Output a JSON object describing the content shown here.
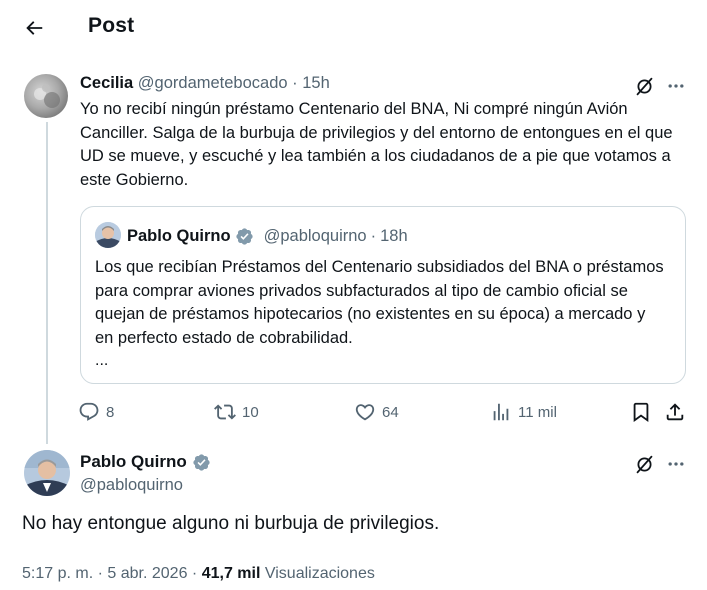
{
  "header": {
    "title": "Post"
  },
  "reply": {
    "name": "Cecilia",
    "handle": "@gordametebocado",
    "separator": "·",
    "time": "15h",
    "text": "Yo no recibí ningún préstamo Centenario del BNA, Ni compré ningún Avión Canciller. Salga de la burbuja de privilegios y del entorno de entongues en el que UD se mueve, y escuché y lea también a los ciudadanos de a pie que votamos a este Gobierno.",
    "quote": {
      "name": "Pablo Quirno",
      "handle": "@pabloquirno",
      "separator": "·",
      "time": "18h",
      "text": "Los que recibían Préstamos del Centenario subsidiados del BNA o préstamos para comprar aviones privados subfacturados al tipo de cambio oficial se quejan de préstamos hipotecarios (no existentes en su época) a mercado y en perfecto estado de cobrabilidad.",
      "more": "..."
    },
    "stats": {
      "replies": "8",
      "reposts": "10",
      "likes": "64",
      "views": "11 mil"
    }
  },
  "main_post": {
    "name": "Pablo Quirno",
    "handle": "@pabloquirno",
    "text": "No hay entongue alguno ni burbuja de privilegios.",
    "time": "5:17 p. m.",
    "separator1": "·",
    "date": "5 abr. 2026",
    "separator2": "·",
    "views_count": "41,7 mil",
    "views_label": "Visualizaciones"
  },
  "colors": {
    "text": "#0f1419",
    "muted": "#536471",
    "border": "#cfd9de",
    "verified": "#829aab"
  },
  "icons": [
    "back-arrow-icon",
    "grok-icon",
    "more-icon",
    "verified-badge-icon",
    "reply-icon",
    "repost-icon",
    "like-icon",
    "views-icon",
    "bookmark-icon",
    "share-icon"
  ]
}
